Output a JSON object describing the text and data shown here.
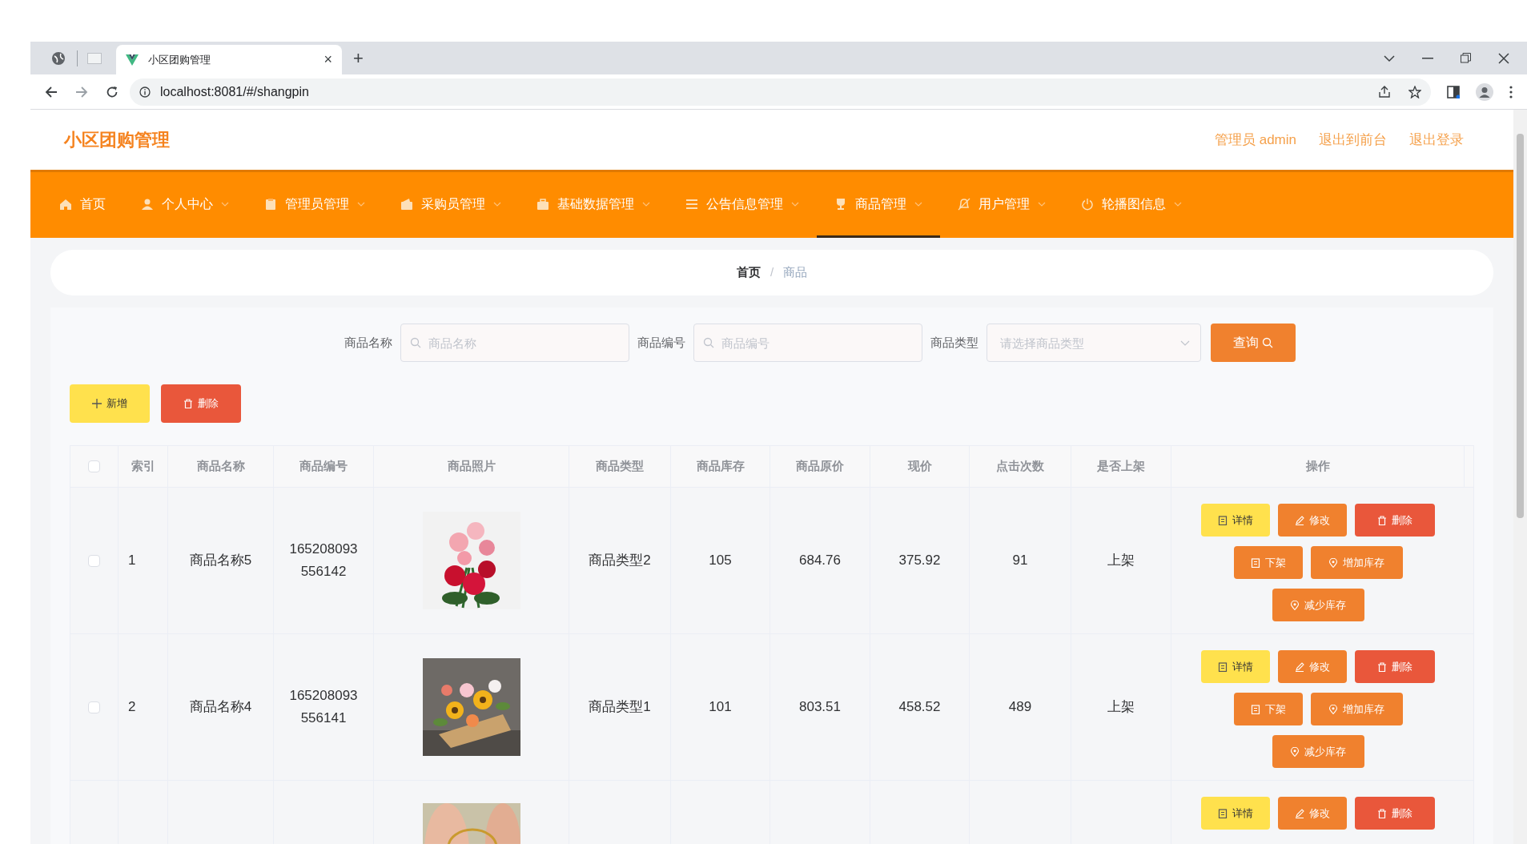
{
  "browser": {
    "tab_title": "小区团购管理",
    "close_glyph": "×",
    "new_tab_glyph": "+",
    "url": "localhost:8081/#/shangpin"
  },
  "header": {
    "title": "小区团购管理",
    "links": [
      "管理员 admin",
      "退出到前台",
      "退出登录"
    ]
  },
  "nav": [
    {
      "label": "首页",
      "has_caret": false,
      "selected": false
    },
    {
      "label": "个人中心",
      "has_caret": true,
      "selected": false
    },
    {
      "label": "管理员管理",
      "has_caret": true,
      "selected": false
    },
    {
      "label": "采购员管理",
      "has_caret": true,
      "selected": false
    },
    {
      "label": "基础数据管理",
      "has_caret": true,
      "selected": false
    },
    {
      "label": "公告信息管理",
      "has_caret": true,
      "selected": false
    },
    {
      "label": "商品管理",
      "has_caret": true,
      "selected": true
    },
    {
      "label": "用户管理",
      "has_caret": true,
      "selected": false
    },
    {
      "label": "轮播图信息",
      "has_caret": true,
      "selected": false
    }
  ],
  "breadcrumb": {
    "items": [
      "首页",
      "商品"
    ],
    "separator": "/"
  },
  "search": {
    "fields": [
      {
        "label": "商品名称",
        "placeholder": "商品名称",
        "kind": "input"
      },
      {
        "label": "商品编号",
        "placeholder": "商品编号",
        "kind": "input"
      },
      {
        "label": "商品类型",
        "placeholder": "请选择商品类型",
        "kind": "select"
      }
    ],
    "button": "查询"
  },
  "actions": [
    {
      "label": "新增",
      "kind": "add"
    },
    {
      "label": "删除",
      "kind": "delete"
    }
  ],
  "table": {
    "header_checked": false,
    "columns": [
      "索引",
      "商品名称",
      "商品编号",
      "商品照片",
      "商品类型",
      "商品库存",
      "商品原价",
      "现价",
      "点击次数",
      "是否上架",
      "操作"
    ],
    "rows": [
      {
        "checked": false,
        "cells": [
          "1",
          "商品名称5",
          "165208093556142",
          "",
          "商品类型2",
          "105",
          "684.76",
          "375.92",
          "91",
          "上架"
        ],
        "ops": [
          {
            "label": "详情",
            "kind": "detail"
          },
          {
            "label": "修改",
            "kind": "edit"
          },
          {
            "label": "删除",
            "kind": "delete"
          },
          {
            "label": "下架",
            "kind": "off"
          },
          {
            "label": "增加库存",
            "kind": "add_stock"
          },
          {
            "label": "减少库存",
            "kind": "reduce_stock"
          }
        ]
      },
      {
        "checked": false,
        "cells": [
          "2",
          "商品名称4",
          "165208093556141",
          "",
          "商品类型1",
          "101",
          "803.51",
          "458.52",
          "489",
          "上架"
        ],
        "ops": [
          {
            "label": "详情",
            "kind": "detail"
          },
          {
            "label": "修改",
            "kind": "edit"
          },
          {
            "label": "删除",
            "kind": "delete"
          },
          {
            "label": "下架",
            "kind": "off"
          },
          {
            "label": "增加库存",
            "kind": "add_stock"
          },
          {
            "label": "减少库存",
            "kind": "reduce_stock"
          }
        ]
      },
      {
        "cells": [
          "",
          "",
          "",
          "",
          "",
          "",
          "",
          "",
          "",
          ""
        ],
        "ops": [
          {
            "label": "详情",
            "kind": "detail"
          },
          {
            "label": "修改",
            "kind": "edit"
          },
          {
            "label": "删除",
            "kind": "delete"
          }
        ]
      }
    ]
  }
}
